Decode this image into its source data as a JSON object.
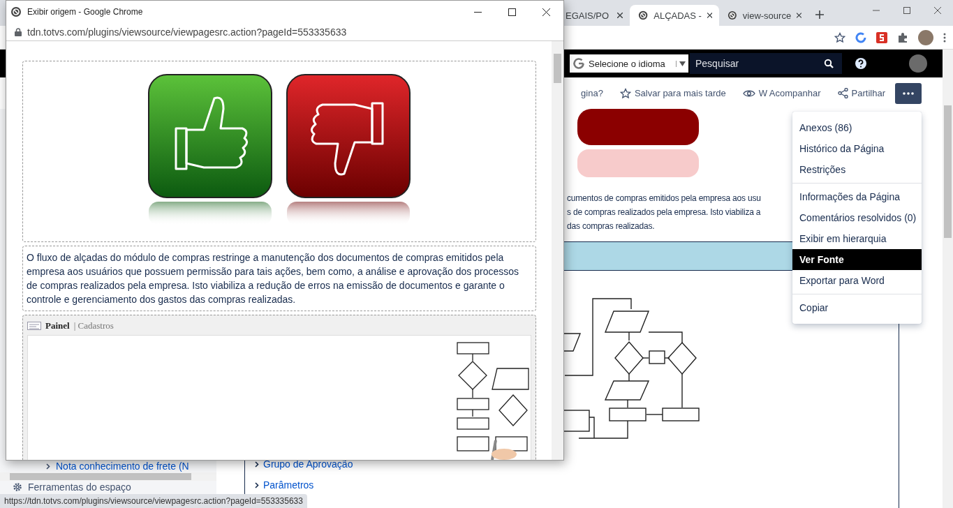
{
  "browser": {
    "tabs": [
      {
        "label": "EGAIS/PO",
        "selected": false
      },
      {
        "label": "ALÇADAS -",
        "selected": true
      },
      {
        "label": "view-source",
        "selected": false
      }
    ]
  },
  "page": {
    "language_select": "Selecione o idioma",
    "search": {
      "placeholder": "Pesquisar"
    },
    "actions": [
      {
        "label": "gina?",
        "kind": "text"
      },
      {
        "label": "Salvar para mais tarde",
        "kind": "star"
      },
      {
        "label": "W Acompanhar",
        "kind": "eye"
      },
      {
        "label": "Partilhar",
        "kind": "share"
      }
    ],
    "intro_lines": [
      "cumentos de compras emitidos pela empresa aos usu",
      "s de compras realizados pela empresa. Isto viabiliza a",
      "das compras realizadas."
    ],
    "sidebar": [
      {
        "label": "Nota conhecimento de frete (N",
        "kind": "link"
      },
      {
        "label": "Ferramentas do espaço",
        "kind": "tools"
      }
    ],
    "links": [
      "Grupo de Aprovação",
      "Parâmetros"
    ]
  },
  "menu": {
    "groups": [
      [
        {
          "label": "Anexos (86)",
          "selected": false
        },
        {
          "label": "Histórico da Página",
          "selected": false
        },
        {
          "label": "Restrições",
          "selected": false
        }
      ],
      [
        {
          "label": "Informações da Página",
          "selected": false
        },
        {
          "label": "Comentários resolvidos (0)",
          "selected": false
        },
        {
          "label": "Exibir em hierarquia",
          "selected": false
        },
        {
          "label": "Ver Fonte",
          "selected": true
        },
        {
          "label": "Exportar para Word",
          "selected": false
        }
      ],
      [
        {
          "label": "Copiar",
          "selected": false
        }
      ]
    ]
  },
  "status_url": "https://tdn.totvs.com/plugins/viewsource/viewpagesrc.action?pageId=553335633",
  "popup": {
    "title": "Exibir origem - Google Chrome",
    "address": "tdn.totvs.com/plugins/viewsource/viewpagesrc.action?pageId=553335633",
    "paragraph": "O fluxo de alçadas do módulo de compras restringe a manutenção dos documentos de compras emitidos pela empresa aos usuários que possuem permissão para tais ações, bem como, a análise e aprovação dos processos de compras realizados pela empresa. Isto viabiliza a redução de erros na emissão de documentos e garante o controle e gerenciamento dos gastos das compras realizadas.",
    "panel": {
      "title": "Painel",
      "subtitle": "| Cadastros"
    }
  }
}
